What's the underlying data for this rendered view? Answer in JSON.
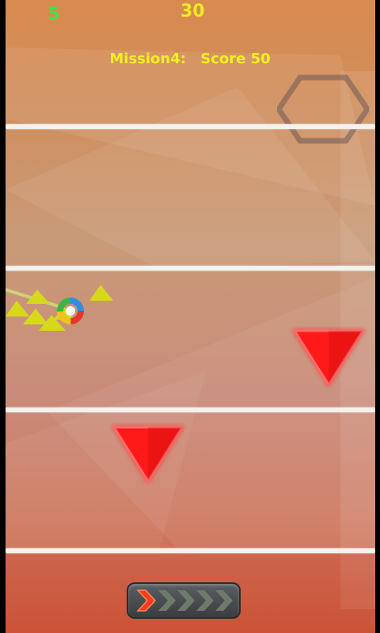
{
  "hud": {
    "lives": "5",
    "timer": "30",
    "mission_label": "Mission4:",
    "score_label": "Score 50"
  },
  "colors": {
    "lives": "#3fe34a",
    "hud_text": "#f3ea23",
    "spike": "#ff1a1a",
    "trail_triangles": "#d6d91a",
    "lane_line": "#f4f1ee"
  },
  "icons": {
    "player": "rainbow-ring-ball-icon",
    "obstacle": "red-triangle-spike-icon",
    "pause": "hexagon-icon",
    "boost": "chevron-right-icon"
  },
  "boost": {
    "level": 0.2,
    "segments_total": 5,
    "segments_active": 1
  }
}
